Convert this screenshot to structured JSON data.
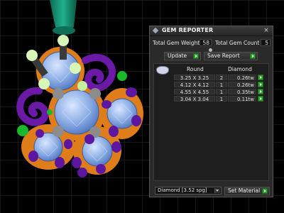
{
  "panel": {
    "title": "GEM REPORTER",
    "close_glyph": "×",
    "total_weight_label": "Total Gem Weight",
    "total_weight_value": "58",
    "total_count_label": "Total Gem Count",
    "total_count_value": "5",
    "update_label": "Update",
    "save_label": "Save Report",
    "table": {
      "col_shape": "Round",
      "col_material": "Diamond",
      "rows": [
        {
          "size": "3.25 X 3.25",
          "count": "2",
          "weight": "0.26tw"
        },
        {
          "size": "4.12 X 4.12",
          "count": "1",
          "weight": "0.26tw"
        },
        {
          "size": "4.55 X 4.55",
          "count": "1",
          "weight": "0.35tw"
        },
        {
          "size": "3.04 X 3.04",
          "count": "1",
          "weight": "0.11tw"
        }
      ]
    },
    "material_select": "Diamond    [3.52 spg]",
    "set_material_label": "Set Material"
  },
  "colors": {
    "grid": "#2b2b2b",
    "gold": "#e07d1b",
    "amethyst": "#6b1aa8",
    "gem_blue": "#8fb0e6",
    "emerald": "#1bb82c",
    "green_button": "#2f9e2f"
  }
}
